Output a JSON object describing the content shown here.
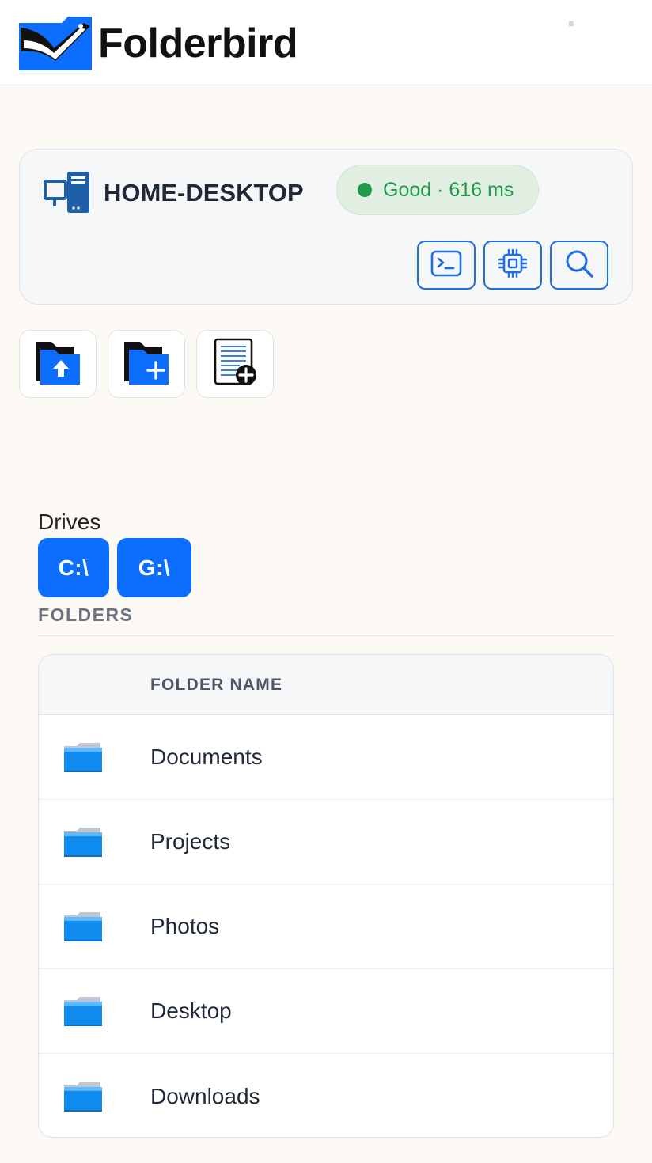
{
  "app": {
    "brand_name": "Folderbird",
    "menu_toggle": "≡"
  },
  "host": {
    "name": "HOME-DESKTOP",
    "status_text": "Good · 616 ms",
    "status_color": "#1e9a4b",
    "actions": [
      {
        "icon": "terminal-icon"
      },
      {
        "icon": "cpu-chip-icon"
      },
      {
        "icon": "search-icon"
      }
    ]
  },
  "tools": [
    {
      "icon": "folder-upload-icon"
    },
    {
      "icon": "folder-add-icon"
    },
    {
      "icon": "new-file-icon"
    }
  ],
  "drives": {
    "label": "Drives",
    "items": [
      "C:\\",
      "G:\\"
    ]
  },
  "folders": {
    "heading": "FOLDERS",
    "column_header": "FOLDER NAME",
    "rows": [
      "Documents",
      "Projects",
      "Photos",
      "Desktop",
      "Downloads"
    ]
  },
  "colors": {
    "accent": "#0d6efd",
    "background": "#fdfaf5"
  }
}
